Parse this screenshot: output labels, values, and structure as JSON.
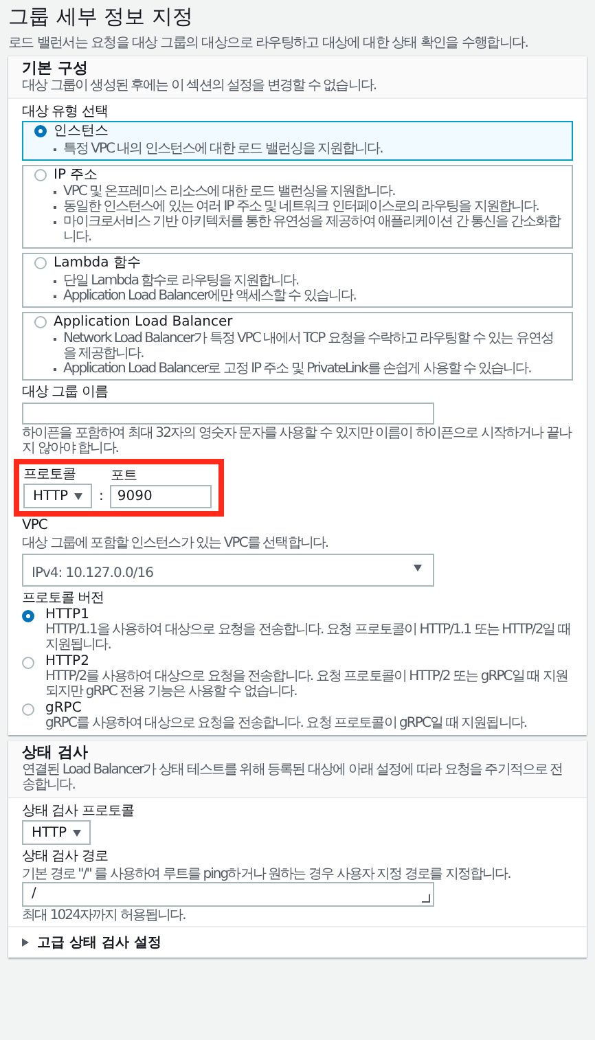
{
  "page": {
    "title": "그룹 세부 정보 지정",
    "description": "로드 밸런서는 요청을 대상 그룹의 대상으로 라우팅하고 대상에 대한 상태 확인을 수행합니다."
  },
  "basic_config": {
    "title": "기본 구성",
    "description": "대상 그룹이 생성된 후에는 이 섹션의 설정을 변경할 수 없습니다.",
    "target_type_label": "대상 유형 선택",
    "target_types": [
      {
        "label": "인스턴스",
        "selected": true,
        "bullets": [
          "특정 VPC 내의 인스턴스에 대한 로드 밸런싱을 지원합니다."
        ]
      },
      {
        "label": "IP 주소",
        "selected": false,
        "bullets": [
          "VPC 및 온프레미스 리소스에 대한 로드 밸런싱을 지원합니다.",
          "동일한 인스턴스에 있는 여러 IP 주소 및 네트워크 인터페이스로의 라우팅을 지원합니다.",
          "마이크로서비스 기반 아키텍처를 통한 유연성을 제공하여 애플리케이션 간 통신을 간소화합니다."
        ]
      },
      {
        "label": "Lambda 함수",
        "selected": false,
        "bullets": [
          "단일 Lambda 함수로 라우팅을 지원합니다.",
          "Application Load Balancer에만 액세스할 수 있습니다."
        ]
      },
      {
        "label": "Application Load Balancer",
        "selected": false,
        "bullets": [
          "Network Load Balancer가 특정 VPC 내에서 TCP 요청을 수락하고 라우팅할 수 있는 유연성을 제공합니다.",
          "Application Load Balancer로 고정 IP 주소 및 PrivateLink를 손쉽게 사용할 수 있습니다."
        ]
      }
    ],
    "name_label": "대상 그룹 이름",
    "name_hint": "하이픈을 포함하여 최대 32자의 영숫자 문자를 사용할 수 있지만 이름이 하이픈으로 시작하거나 끝나지 않아야 합니다.",
    "highlighted": true,
    "protocol_label": "프로토콜",
    "protocol_value": "HTTP",
    "separator": ":",
    "port_label": "포트",
    "port_value": "9090",
    "vpc_label": "VPC",
    "vpc_description": "대상 그룹에 포함할 인스턴스가 있는 VPC를 선택합니다.",
    "vpc_detail": "IPv4: 10.127.0.0/16",
    "protocol_version_label": "프로토콜 버전",
    "protocol_versions": [
      {
        "label": "HTTP1",
        "selected": true,
        "description": "HTTP/1.1을 사용하여 대상으로 요청을 전송합니다. 요청 프로토콜이 HTTP/1.1 또는 HTTP/2일 때 지원됩니다."
      },
      {
        "label": "HTTP2",
        "selected": false,
        "description": "HTTP/2를 사용하여 대상으로 요청을 전송합니다. 요청 프로토콜이 HTTP/2 또는 gRPC일 때 지원되지만 gRPC 전용 기능은 사용할 수 없습니다."
      },
      {
        "label": "gRPC",
        "selected": false,
        "description": "gRPC를 사용하여 대상으로 요청을 전송합니다. 요청 프로토콜이 gRPC일 때 지원됩니다."
      }
    ]
  },
  "health_check": {
    "title": "상태 검사",
    "description": "연결된 Load Balancer가 상태 테스트를 위해 등록된 대상에 아래 설정에 따라 요청을 주기적으로 전송합니다.",
    "protocol_label": "상태 검사 프로토콜",
    "protocol_value": "HTTP",
    "path_label": "상태 검사 경로",
    "path_description": "기본 경로 \"/\" 를 사용하여 루트를 ping하거나 원하는 경우 사용자 지정 경로를 지정합니다.",
    "path_value": "/",
    "path_hint": "최대 1024자까지 허용됩니다.",
    "advanced": {
      "label": "고급 상태 검사 설정",
      "expanded": false
    }
  }
}
